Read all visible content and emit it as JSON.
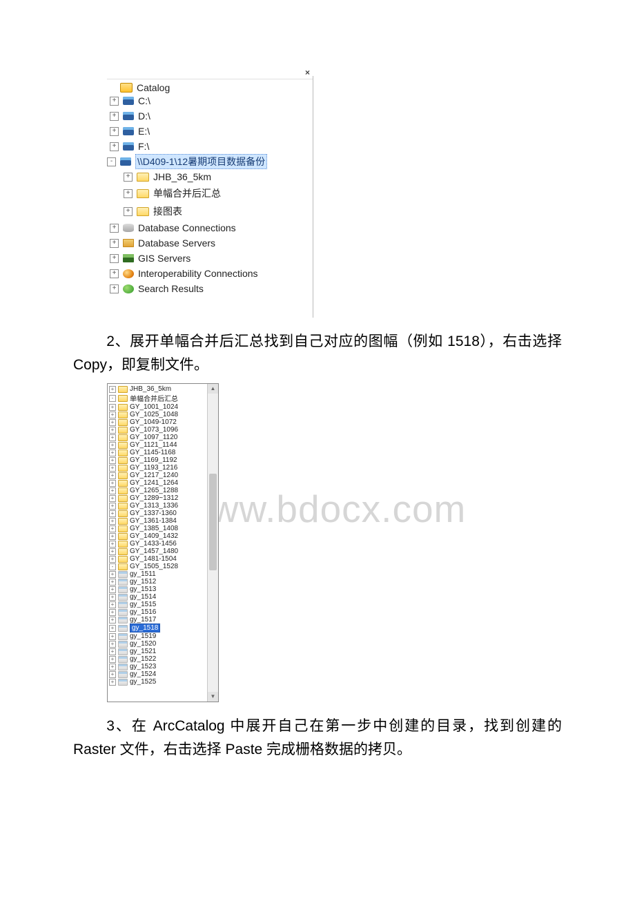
{
  "watermark": "www.bdocx.com",
  "panel1": {
    "close": "×",
    "root": "Catalog",
    "drives": [
      "C:\\",
      "D:\\",
      "E:\\",
      "F:\\"
    ],
    "network": {
      "path": "\\\\D409-1\\12暑期项目数据备份",
      "children": [
        "JHB_36_5km",
        "单幅合并后汇总",
        "接图表"
      ]
    },
    "tail": [
      "Database Connections",
      "Database Servers",
      "GIS Servers",
      "Interoperability Connections",
      "Search Results"
    ]
  },
  "para2": "2、展开单幅合并后汇总找到自己对应的图幅（例如 1518），右击选择 Copy，即复制文件。",
  "panel2": {
    "top": [
      {
        "label": "JHB_36_5km",
        "exp": "+",
        "type": "folder"
      },
      {
        "label": "单幅合并后汇总",
        "exp": "-",
        "type": "folder"
      }
    ],
    "gy_folders": [
      "GY_1001_1024",
      "GY_1025_1048",
      "GY_1049-1072",
      "GY_1073_1096",
      "GY_1097_1120",
      "GY_1121_1144",
      "GY_1145-1168",
      "GY_1169_1192",
      "GY_1193_1216",
      "GY_1217_1240",
      "GY_1241_1264",
      "GY_1265_1288",
      "GY_1289~1312",
      "GY_1313_1336",
      "GY_1337-1360",
      "GY_1361-1384",
      "GY_1385_1408",
      "GY_1409_1432",
      "GY_1433-1456",
      "GY_1457_1480",
      "GY_1481-1504"
    ],
    "open_folder": "GY_1505_1528",
    "rasters": [
      "gy_1511",
      "gy_1512",
      "gy_1513",
      "gy_1514",
      "gy_1515",
      "gy_1516",
      "gy_1517",
      "gy_1518",
      "gy_1519",
      "gy_1520",
      "gy_1521",
      "gy_1522",
      "gy_1523",
      "gy_1524",
      "gy_1525"
    ],
    "selected": "gy_1518"
  },
  "para3": "3、在 ArcCatalog 中展开自己在第一步中创建的目录，找到创建的 Raster 文件，右击选择 Paste 完成栅格数据的拷贝。"
}
